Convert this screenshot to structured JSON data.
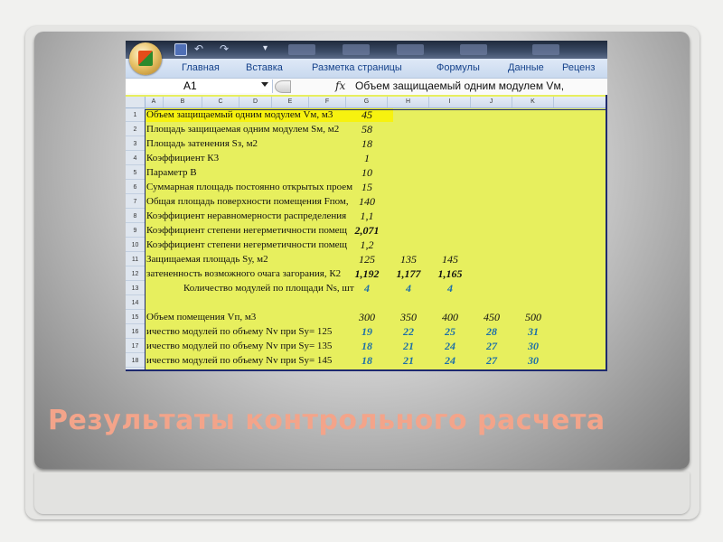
{
  "slide": {
    "title": "Результаты контрольного расчета"
  },
  "excel": {
    "ribbon_tabs": [
      "Главная",
      "Вставка",
      "Разметка страницы",
      "Формулы",
      "Данные",
      "Реценз"
    ],
    "name_box": "A1",
    "formula_icon": "fx",
    "formula_content": "Объем защищаемый одним модулем Vм,",
    "columns": [
      "A",
      "B",
      "C",
      "D",
      "E",
      "F",
      "G",
      "H",
      "I",
      "J",
      "K"
    ],
    "rows": [
      {
        "num": "1",
        "label": "Объем защищаемый одним модулем Vм, м3",
        "highlight": true,
        "values": [
          "45"
        ]
      },
      {
        "num": "2",
        "label": "Площадь защищаемая одним модулем Sм, м2",
        "values": [
          "58"
        ]
      },
      {
        "num": "3",
        "label": "Площадь затенения Sз, м2",
        "values": [
          "18"
        ]
      },
      {
        "num": "4",
        "label": "Коэффициент К3",
        "values": [
          "1"
        ]
      },
      {
        "num": "5",
        "label": "Параметр В",
        "values": [
          "10"
        ]
      },
      {
        "num": "6",
        "label": "Суммарная площадь постоянно открытых проем",
        "values": [
          "15"
        ]
      },
      {
        "num": "7",
        "label": "Общая площадь поверхности помещения Fпом,",
        "values": [
          "140"
        ]
      },
      {
        "num": "8",
        "label": "Коэффициент неравномерности распределения",
        "values": [
          "1,1"
        ]
      },
      {
        "num": "9",
        "label": "Коэффициент степени негерметичности помещ",
        "bold": true,
        "values": [
          "2,071"
        ]
      },
      {
        "num": "10",
        "label": "Коэффициент степени негерметичности помещ",
        "values": [
          "1,2"
        ]
      },
      {
        "num": "11",
        "label": "Защищаемая площадь Sу, м2",
        "values": [
          "125",
          "135",
          "145"
        ]
      },
      {
        "num": "12",
        "label": "затененность возможного очага загорания, К2",
        "bold": true,
        "values": [
          "1,192",
          "1,177",
          "1,165"
        ]
      },
      {
        "num": "13",
        "label": "Количество модулей по площади Ns, шт",
        "indent": true,
        "blue": true,
        "values": [
          "4",
          "4",
          "4"
        ]
      },
      {
        "num": "14",
        "label": "",
        "values": []
      },
      {
        "num": "15",
        "label": "Объем помещения Vп, м3",
        "values": [
          "300",
          "350",
          "400",
          "450",
          "500"
        ]
      },
      {
        "num": "16",
        "label": "ичество модулей по объему Nv при Sу= 125",
        "blue": true,
        "values": [
          "19",
          "22",
          "25",
          "28",
          "31"
        ]
      },
      {
        "num": "17",
        "label": "ичество модулей по объему Nv при Sу= 135",
        "blue": true,
        "values": [
          "18",
          "21",
          "24",
          "27",
          "30"
        ]
      },
      {
        "num": "18",
        "label": "ичество модулей по объему Nv при Sу= 145",
        "blue": true,
        "values": [
          "18",
          "21",
          "24",
          "27",
          "30"
        ]
      }
    ]
  }
}
